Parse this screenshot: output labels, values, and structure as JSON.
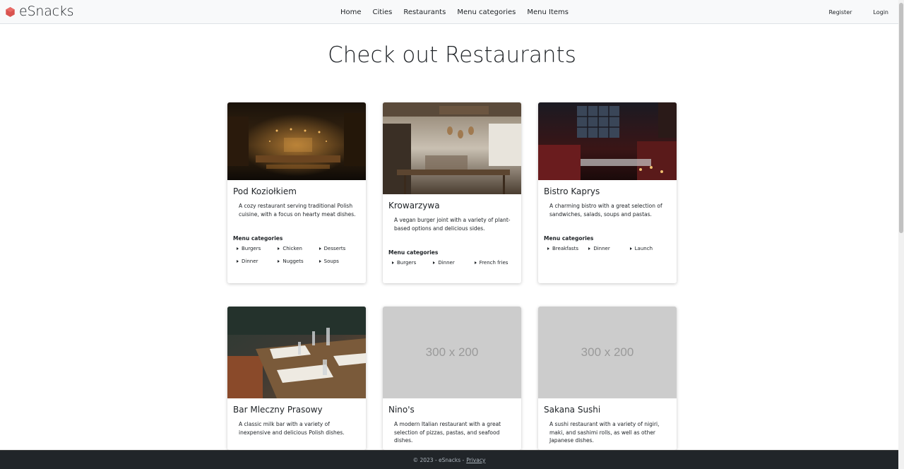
{
  "brand": {
    "name": "eSnacks",
    "logo_icon": "hexagon-logo-icon",
    "logo_color": "#d9534f"
  },
  "nav": {
    "links": [
      "Home",
      "Cities",
      "Restaurants",
      "Menu categories",
      "Menu Items"
    ],
    "register": "Register",
    "login": "Login"
  },
  "page": {
    "title": "Check out Restaurants"
  },
  "restaurants": [
    {
      "name": "Pod Koziołkiem",
      "description": "A cozy restaurant serving traditional Polish cuisine, with a focus on hearty meat dishes.",
      "image": "restaurant-interior-warm-bar",
      "categories_heading": "Menu categories",
      "categories": [
        "Burgers",
        "Chicken",
        "Desserts",
        "Dinner",
        "Nuggets",
        "Soups"
      ]
    },
    {
      "name": "Krowarzywa",
      "description": "A vegan burger joint with a variety of plant-based options and delicious sides.",
      "image": "restaurant-interior-bright-cafe",
      "categories_heading": "Menu categories",
      "categories": [
        "Burgers",
        "Dinner",
        "French fries"
      ]
    },
    {
      "name": "Bistro Kaprys",
      "description": "A charming bistro with a great selection of sandwiches, salads, soups and pastas.",
      "image": "restaurant-interior-red-tables",
      "categories_heading": "Menu categories",
      "categories": [
        "Breakfasts",
        "Dinner",
        "Launch"
      ]
    },
    {
      "name": "Bar Mleczny Prasowy",
      "description": "A classic milk bar with a variety of inexpensive and delicious Polish dishes.",
      "image": "restaurant-table-setting"
    },
    {
      "name": "Nino's",
      "description": "A modern Italian restaurant with a great selection of pizzas, pastas, and seafood dishes.",
      "placeholder": "300 x 200"
    },
    {
      "name": "Sakana Sushi",
      "description": "A sushi restaurant with a variety of nigiri, maki, and sashimi rolls, as well as other Japanese dishes.",
      "placeholder": "300 x 200"
    }
  ],
  "footer": {
    "copyright": "© 2023 - eSnacks -",
    "privacy": "Privacy"
  }
}
